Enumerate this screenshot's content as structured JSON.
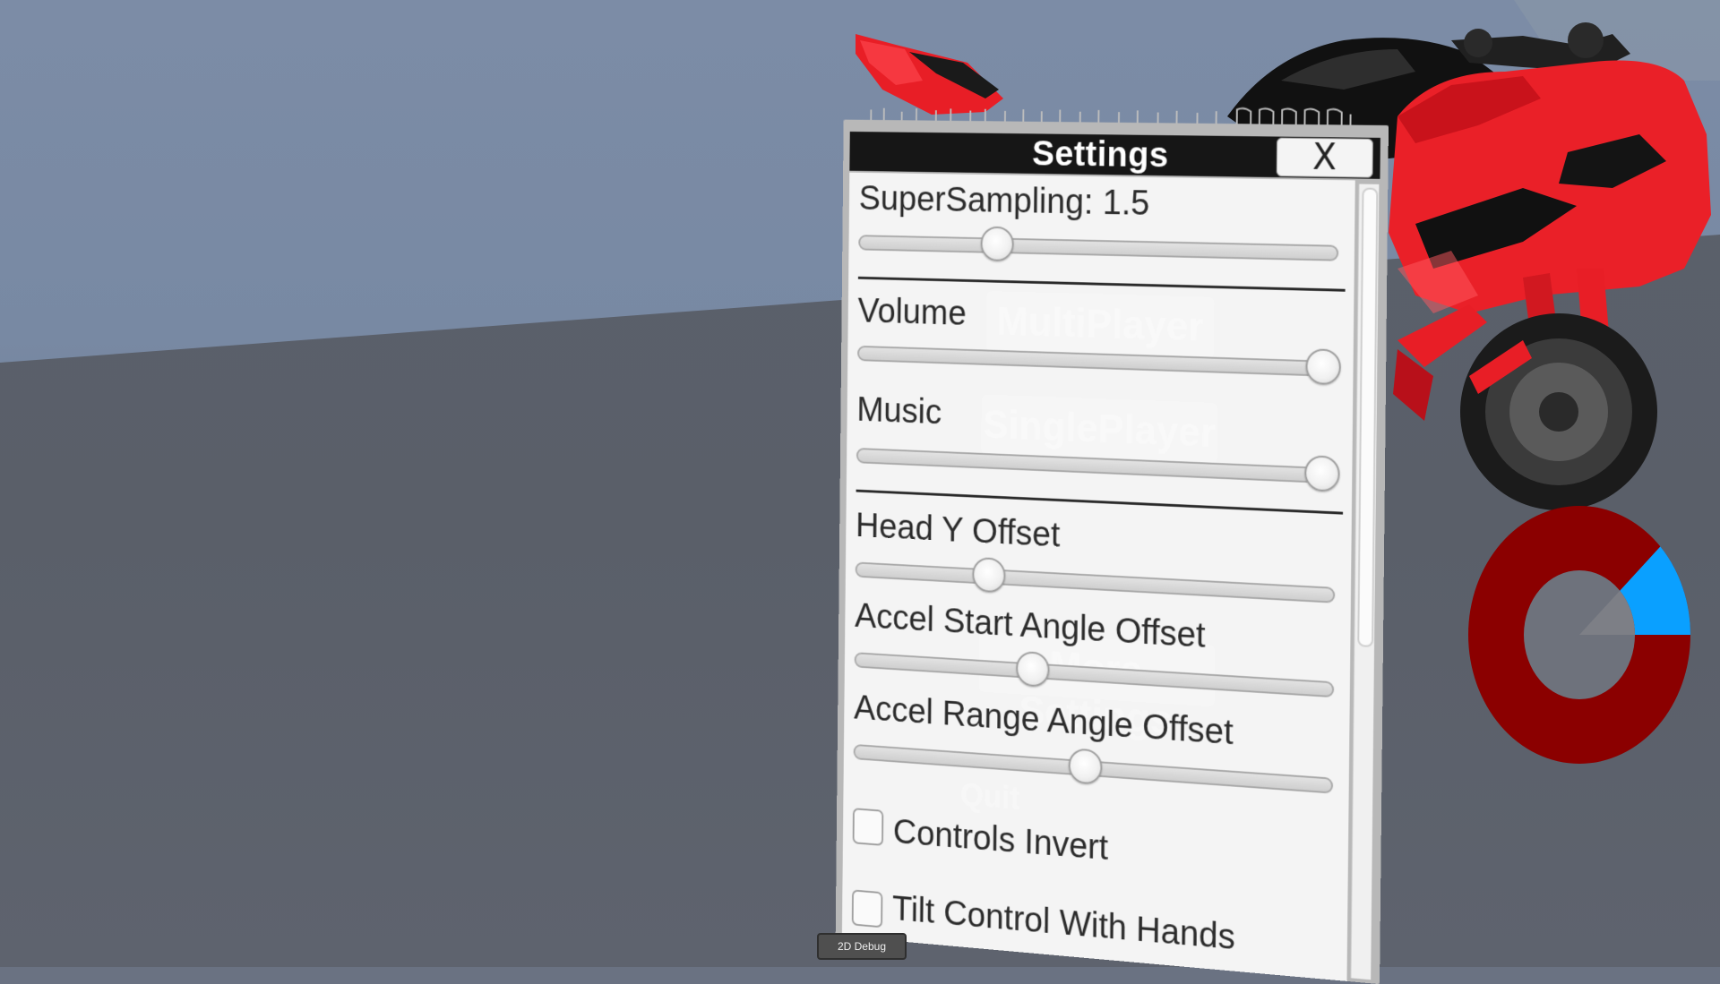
{
  "settings": {
    "title": "Settings",
    "close_label": "X",
    "supersampling": {
      "label": "SuperSampling: 1.5",
      "value_fraction": 0.28
    },
    "volume": {
      "label": "Volume",
      "value_fraction": 1.0
    },
    "music": {
      "label": "Music",
      "value_fraction": 1.0
    },
    "head_y_offset": {
      "label": "Head Y Offset",
      "value_fraction": 0.27
    },
    "accel_start_angle_offset": {
      "label": "Accel Start Angle Offset",
      "value_fraction": 0.37
    },
    "accel_range_angle_offset": {
      "label": "Accel Range Angle Offset",
      "value_fraction": 0.49
    },
    "controls_invert": {
      "label": "Controls Invert",
      "checked": false
    },
    "tilt_control_with_hands": {
      "label": "Tilt Control With Hands",
      "checked": false
    }
  },
  "background_menu": {
    "items": [
      "MultiPlayer",
      "SinglePlayer",
      "More Settings",
      "Quit"
    ]
  },
  "debug": {
    "label": "2D Debug"
  },
  "gauge": {
    "fill_fraction": 0.12,
    "ring_color": "#8b0000",
    "fill_color": "#0aa0ff",
    "center_color": "#6e727c"
  },
  "colors": {
    "bike_red": "#e8202a",
    "panel_bg": "#f4f4f4",
    "title_bg": "#161616"
  }
}
